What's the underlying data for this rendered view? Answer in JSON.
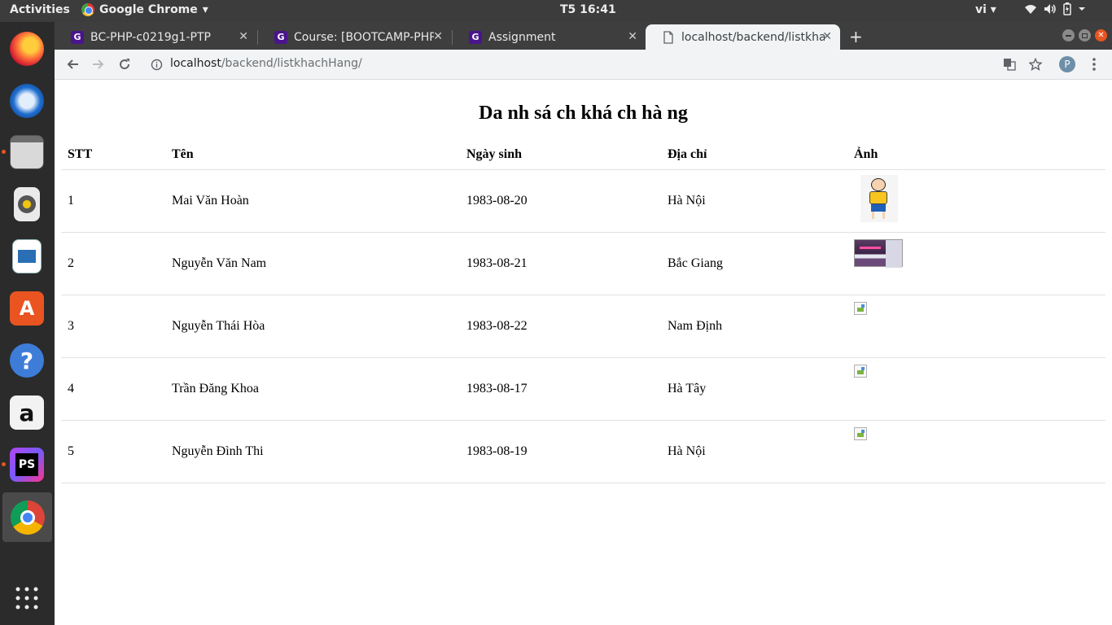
{
  "topbar": {
    "activities": "Activities",
    "app_name": "Google Chrome",
    "app_menu_arrow": "▾",
    "clock": "T5 16:41",
    "language": "vi ▾",
    "tray_icons": [
      "wifi-icon",
      "volume-icon",
      "battery-icon",
      "chevron-down-icon"
    ]
  },
  "dock": {
    "items": [
      "firefox",
      "thunderbird",
      "files",
      "rhythmbox",
      "libreoffice-writer",
      "ubuntu-software",
      "help",
      "amazon",
      "phpstorm",
      "chrome",
      "show-applications"
    ]
  },
  "browser": {
    "tabs": [
      {
        "title": "BC-PHP-c0219g1-PTP",
        "favicon": "codegym-icon"
      },
      {
        "title": "Course: [BOOTCAMP-PHP",
        "favicon": "codegym-icon"
      },
      {
        "title": "Assignment",
        "favicon": "codegym-icon"
      },
      {
        "title": "localhost/backend/listkha",
        "favicon": "page-icon"
      }
    ],
    "tab_close": "✕",
    "new_tab": "+",
    "url_host": "localhost",
    "url_path": "/backend/listkhachHang/",
    "profile_initial": "P"
  },
  "page": {
    "title": "Da nh sá ch khá ch hà ng",
    "table": {
      "headers": [
        "STT",
        "Tên",
        "Ngày sinh",
        "Địa chỉ",
        "Ảnh"
      ],
      "rows": [
        {
          "stt": "1",
          "name": "Mai Văn Hoàn",
          "dob": "1983-08-20",
          "address": "Hà Nội",
          "image": "nobita-cartoon"
        },
        {
          "stt": "2",
          "name": "Nguyễn Văn Nam",
          "dob": "1983-08-21",
          "address": "Bắc Giang",
          "image": "screenshot-thumbnail"
        },
        {
          "stt": "3",
          "name": "Nguyễn Thái Hòa",
          "dob": "1983-08-22",
          "address": "Nam Định",
          "image": "broken-image"
        },
        {
          "stt": "4",
          "name": "Trần Đăng Khoa",
          "dob": "1983-08-17",
          "address": "Hà Tây",
          "image": "broken-image"
        },
        {
          "stt": "5",
          "name": "Nguyễn Đình Thi",
          "dob": "1983-08-19",
          "address": "Hà Nội",
          "image": "broken-image"
        }
      ]
    }
  }
}
